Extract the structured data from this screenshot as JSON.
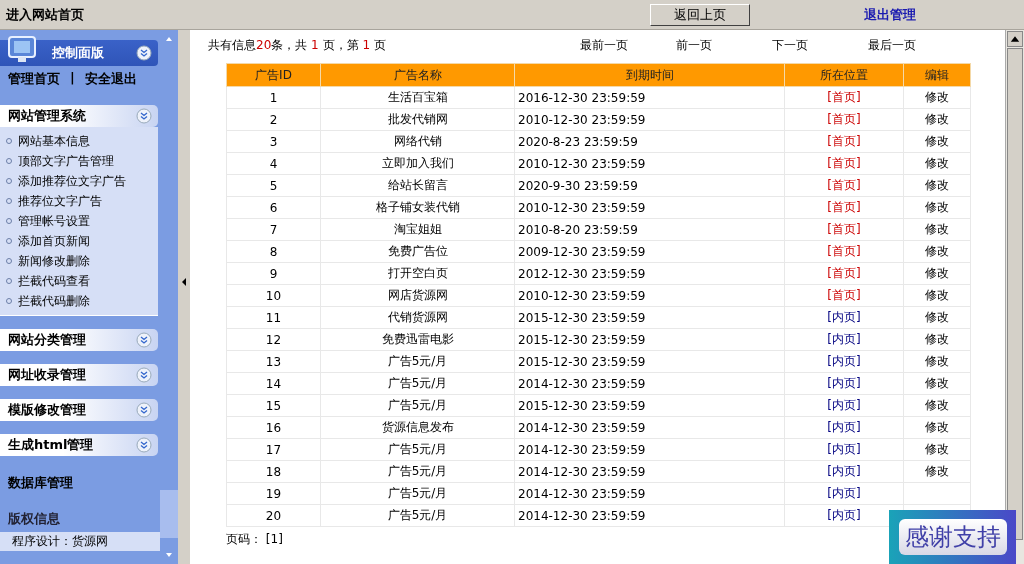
{
  "top_bar": {
    "home_link": "进入网站首页",
    "back_button": "返回上页",
    "logout_link": "退出管理"
  },
  "sidebar": {
    "panel_title": "控制面版",
    "links": [
      "管理首页",
      "安全退出"
    ],
    "separator": "|",
    "sections": [
      {
        "title": "网站管理系统",
        "items": [
          "网站基本信息",
          "顶部文字广告管理",
          "添加推荐位文字广告",
          "推荐位文字广告",
          "管理帐号设置",
          "添加首页新闻",
          "新闻修改删除",
          "拦截代码查看",
          "拦截代码删除"
        ]
      },
      {
        "title": "网站分类管理"
      },
      {
        "title": "网址收录管理"
      },
      {
        "title": "模版修改管理"
      },
      {
        "title": "生成html管理"
      }
    ],
    "database_heading": "数据库管理",
    "copyright_heading": "版权信息",
    "credit": "程序设计：货源网"
  },
  "summary": {
    "prefix": "共有信息",
    "count": "20",
    "middle": "条，共 ",
    "pages": "1",
    "middle2": " 页，第 ",
    "page": "1",
    "suffix": " 页"
  },
  "pager": [
    "最前一页",
    "前一页",
    "下一页",
    "最后一页"
  ],
  "table": {
    "columns": [
      "广告ID",
      "广告名称",
      "到期时间",
      "所在位置",
      "编辑"
    ],
    "rows": [
      {
        "id": "1",
        "name": "生活百宝箱",
        "expires": "2016-12-30 23:59:59",
        "position": "[首页]",
        "kind": "home",
        "edit": "修改"
      },
      {
        "id": "2",
        "name": "批发代销网",
        "expires": "2010-12-30 23:59:59",
        "position": "[首页]",
        "kind": "home",
        "edit": "修改"
      },
      {
        "id": "3",
        "name": "网络代销",
        "expires": "2020-8-23 23:59:59",
        "position": "[首页]",
        "kind": "home",
        "edit": "修改"
      },
      {
        "id": "4",
        "name": "立即加入我们",
        "expires": "2010-12-30 23:59:59",
        "position": "[首页]",
        "kind": "home",
        "edit": "修改"
      },
      {
        "id": "5",
        "name": "给站长留言",
        "expires": "2020-9-30 23:59:59",
        "position": "[首页]",
        "kind": "home",
        "edit": "修改"
      },
      {
        "id": "6",
        "name": "格子铺女装代销",
        "expires": "2010-12-30 23:59:59",
        "position": "[首页]",
        "kind": "home",
        "edit": "修改"
      },
      {
        "id": "7",
        "name": "淘宝姐姐",
        "expires": "2010-8-20 23:59:59",
        "position": "[首页]",
        "kind": "home",
        "edit": "修改"
      },
      {
        "id": "8",
        "name": "免费广告位",
        "expires": "2009-12-30 23:59:59",
        "position": "[首页]",
        "kind": "home",
        "edit": "修改"
      },
      {
        "id": "9",
        "name": "打开空白页",
        "expires": "2012-12-30 23:59:59",
        "position": "[首页]",
        "kind": "home",
        "edit": "修改"
      },
      {
        "id": "10",
        "name": "网店货源网",
        "expires": "2010-12-30 23:59:59",
        "position": "[首页]",
        "kind": "home",
        "edit": "修改"
      },
      {
        "id": "11",
        "name": "代销货源网",
        "expires": "2015-12-30 23:59:59",
        "position": "[内页]",
        "kind": "inner",
        "edit": "修改"
      },
      {
        "id": "12",
        "name": "免费迅雷电影",
        "expires": "2015-12-30 23:59:59",
        "position": "[内页]",
        "kind": "inner",
        "edit": "修改"
      },
      {
        "id": "13",
        "name": "广告5元/月",
        "expires": "2015-12-30 23:59:59",
        "position": "[内页]",
        "kind": "inner",
        "edit": "修改"
      },
      {
        "id": "14",
        "name": "广告5元/月",
        "expires": "2014-12-30 23:59:59",
        "position": "[内页]",
        "kind": "inner",
        "edit": "修改"
      },
      {
        "id": "15",
        "name": "广告5元/月",
        "expires": "2015-12-30 23:59:59",
        "position": "[内页]",
        "kind": "inner",
        "edit": "修改"
      },
      {
        "id": "16",
        "name": "货源信息发布",
        "expires": "2014-12-30 23:59:59",
        "position": "[内页]",
        "kind": "inner",
        "edit": "修改"
      },
      {
        "id": "17",
        "name": "广告5元/月",
        "expires": "2014-12-30 23:59:59",
        "position": "[内页]",
        "kind": "inner",
        "edit": "修改"
      },
      {
        "id": "18",
        "name": "广告5元/月",
        "expires": "2014-12-30 23:59:59",
        "position": "[内页]",
        "kind": "inner",
        "edit": "修改"
      },
      {
        "id": "19",
        "name": "广告5元/月",
        "expires": "2014-12-30 23:59:59",
        "position": "[内页]",
        "kind": "inner"
      },
      {
        "id": "20",
        "name": "广告5元/月",
        "expires": "2014-12-30 23:59:59",
        "position": "[内页]",
        "kind": "inner"
      }
    ]
  },
  "page_links": {
    "label": "页码：",
    "pages": "[1]"
  },
  "badge": "感谢支持"
}
